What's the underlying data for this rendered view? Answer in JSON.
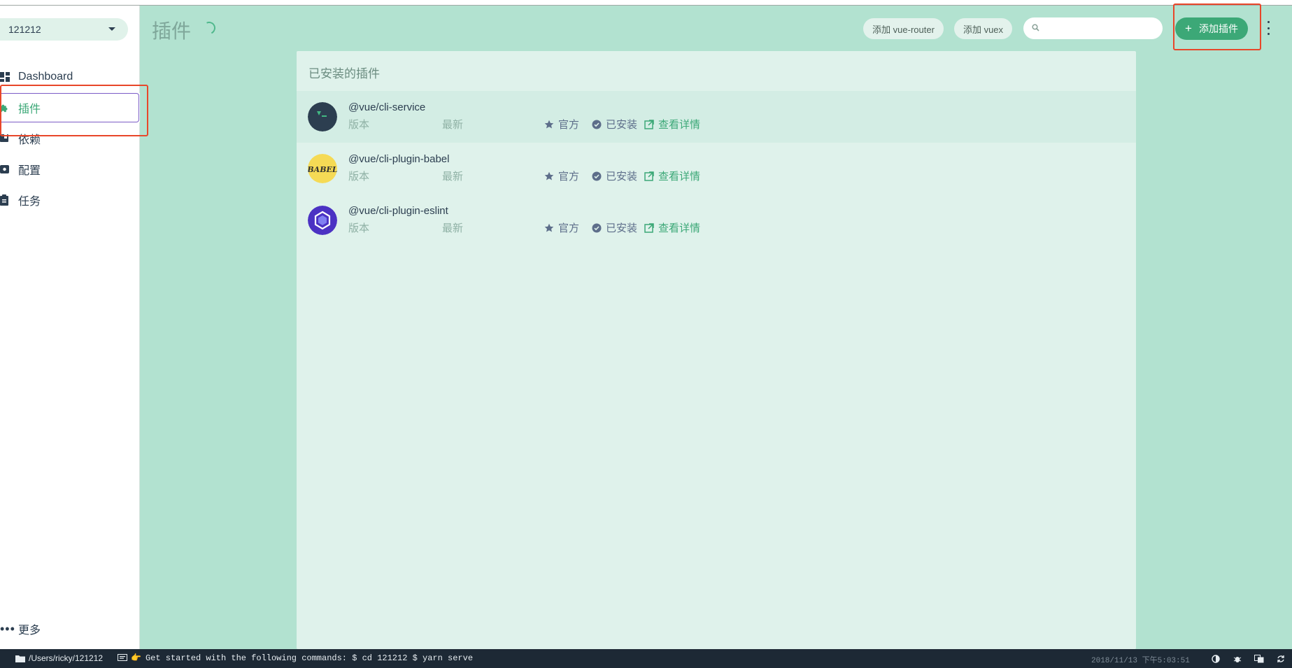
{
  "project": {
    "name": "121212"
  },
  "sidebar": {
    "items": [
      {
        "label": "Dashboard",
        "icon": "dashboard-icon"
      },
      {
        "label": "插件",
        "icon": "puzzle-icon",
        "active": true
      },
      {
        "label": "依赖",
        "icon": "book-icon"
      },
      {
        "label": "配置",
        "icon": "gear-icon"
      },
      {
        "label": "任务",
        "icon": "clipboard-icon"
      }
    ],
    "more_label": "更多"
  },
  "header": {
    "title": "插件",
    "add_vue_router": "添加 vue-router",
    "add_vuex": "添加 vuex",
    "search_placeholder": "",
    "add_plugin": "添加插件"
  },
  "panel": {
    "title": "已安装的插件",
    "plugins": [
      {
        "name": "@vue/cli-service",
        "version_label": "版本",
        "latest_label": "最新",
        "official": "官方",
        "installed": "已安装",
        "details": "查看详情",
        "logo": "vue-cli-logo"
      },
      {
        "name": "@vue/cli-plugin-babel",
        "version_label": "版本",
        "latest_label": "最新",
        "official": "官方",
        "installed": "已安装",
        "details": "查看详情",
        "logo": "babel-logo",
        "logo_text": "BABEL"
      },
      {
        "name": "@vue/cli-plugin-eslint",
        "version_label": "版本",
        "latest_label": "最新",
        "official": "官方",
        "installed": "已安装",
        "details": "查看详情",
        "logo": "eslint-logo"
      }
    ]
  },
  "statusbar": {
    "path": "/Users/ricky/121212",
    "message": "Get started with the following commands: $ cd 121212 $ yarn serve",
    "timestamp": "2018/11/13 下午5:03:51"
  },
  "colors": {
    "accent": "#3ca877",
    "background": "#b2e2d0",
    "panel": "#dff2eb",
    "highlight": "#e8472a",
    "statusbar": "#1d2935"
  }
}
